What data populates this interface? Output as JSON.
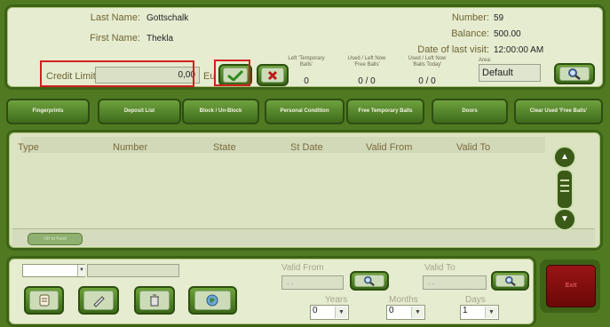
{
  "person": {
    "last_name_label": "Last Name:",
    "last_name": "Gottschalk",
    "first_name_label": "First Name:",
    "first_name": "Thekla"
  },
  "account": {
    "number_label": "Number:",
    "number": "59",
    "balance_label": "Balance:",
    "balance": "500.00",
    "last_visit_label": "Date of last visit:",
    "last_visit": "12:00:00 AM"
  },
  "credit": {
    "label": "Credit Limit:",
    "value": "0,00",
    "currency": "Eu"
  },
  "counters": {
    "temp_left_label": "Left 'Temporary Balls'",
    "temp_left_value": "0",
    "free_used_label": "Used / Left Now 'Free Balls'",
    "free_used_value": "0 / 0",
    "balls_today_label": "Used / Left Now 'Balls Today'",
    "balls_today_value": "0 / 0",
    "area_label": "Area:",
    "area_value": "Default"
  },
  "nav": {
    "fingerprints": "Fingerprints",
    "deposit_list": "Deposit List",
    "block_unblock": "Block / Un-Block",
    "personal_condition": "Personal Condition",
    "free_temporary_balls": "Free Temporary Balls",
    "doors": "Doors",
    "clear_used_free_balls": "Clear Used 'Free Balls'"
  },
  "table": {
    "columns": [
      "Type",
      "Number",
      "State",
      "St Date",
      "Valid From",
      "Valid To"
    ],
    "rows": [],
    "footer_button": "OK to Fund"
  },
  "bottom": {
    "type_select": "",
    "number_input": "",
    "valid_from_label": "Valid From",
    "valid_from_value": ". .",
    "valid_to_label": "Valid To",
    "valid_to_value": ". .",
    "years_label": "Years",
    "years_value": "0",
    "months_label": "Months",
    "months_value": "0",
    "days_label": "Days",
    "days_value": "1",
    "exit_button": "Exit"
  },
  "colors": {
    "frame_green": "#4f7a22",
    "panel_bg": "#e6ecd0",
    "accent_red": "#8c1010",
    "highlight_red": "#d32020"
  }
}
